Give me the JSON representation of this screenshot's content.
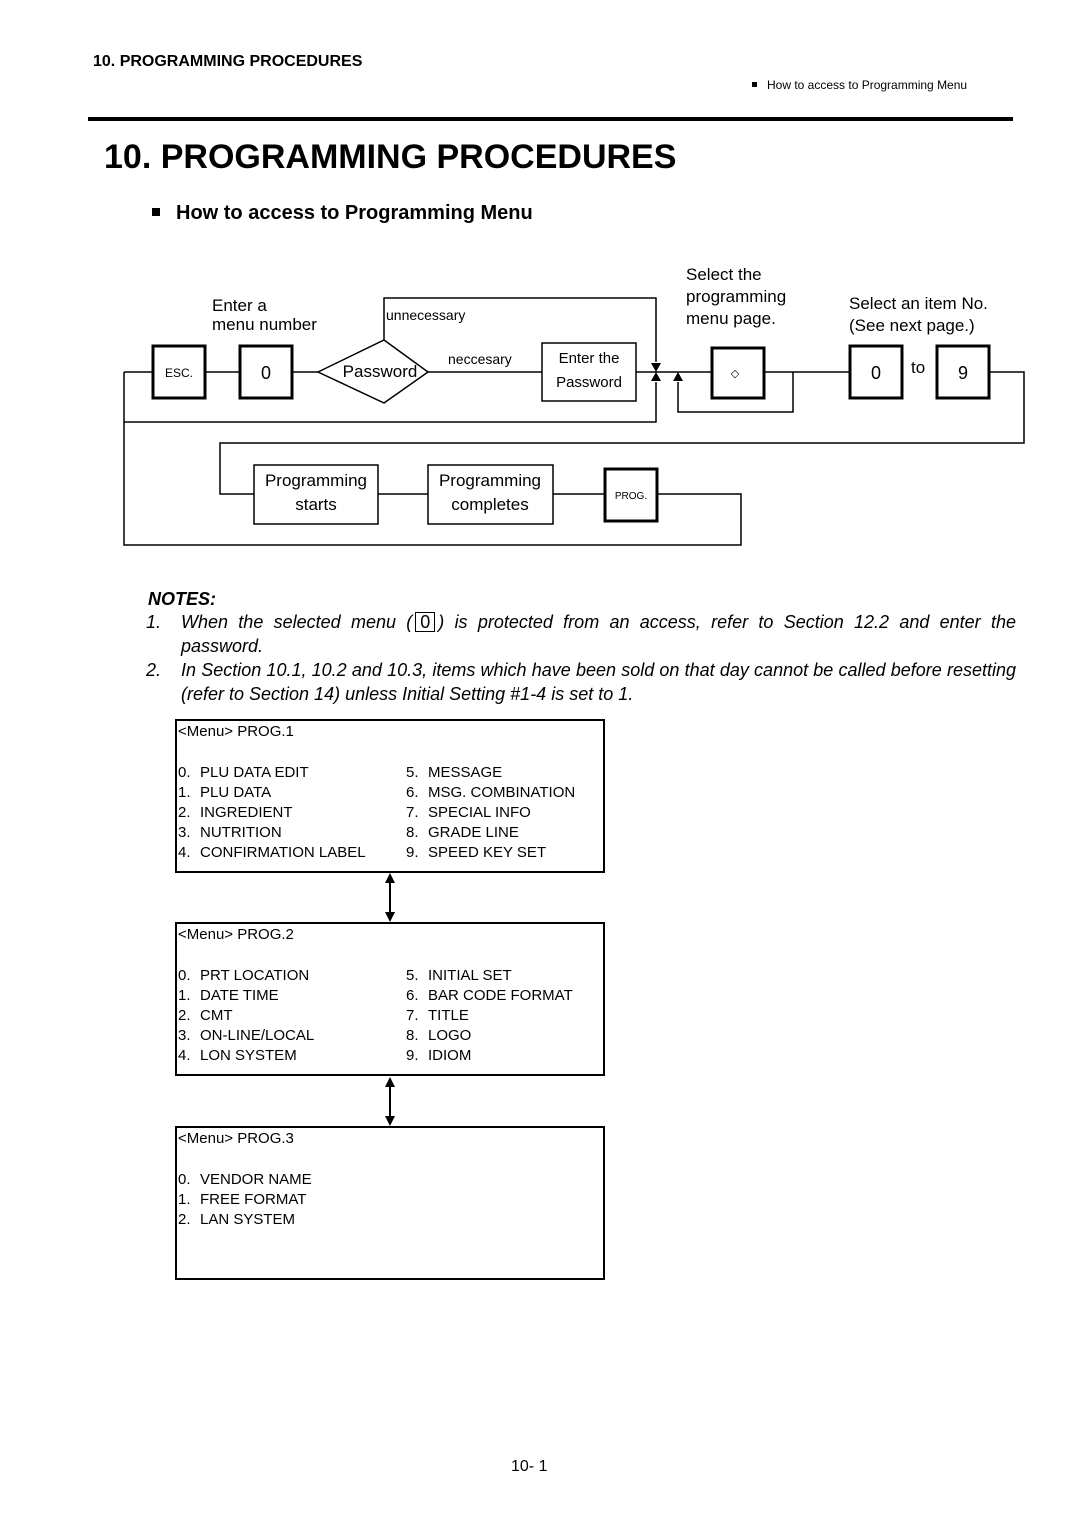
{
  "header": {
    "running_title": "10. PROGRAMMING PROCEDURES",
    "running_section": "How to access to Programming Menu"
  },
  "chapter_title": "10.  PROGRAMMING PROCEDURES",
  "section_heading": "How to access to Programming Menu",
  "flow": {
    "enter_menu_line1": "Enter a",
    "enter_menu_line2": "menu number",
    "unnecessary": "unnecessary",
    "neccesary": "neccesary",
    "select_page_line1": "Select the",
    "select_page_line2": "programming",
    "select_page_line3": "menu page.",
    "select_item_line1": "Select an item No.",
    "select_item_line2": "(See next page.)",
    "esc_key": "ESC.",
    "zero_key": "0",
    "password_decision": "Password",
    "enter_password_line1": "Enter the",
    "enter_password_line2": "Password",
    "page_key_glyph": "◇",
    "item_key_from": "0",
    "to_label": "to",
    "item_key_to": "9",
    "prog_starts_line1": "Programming",
    "prog_starts_line2": "starts",
    "prog_completes_line1": "Programming",
    "prog_completes_line2": "completes",
    "prog_key": "PROG."
  },
  "notes": {
    "title": "NOTES:",
    "items": [
      {
        "num": "1.",
        "before": "When the selected menu (",
        "key": "0",
        "after": ") is protected from  an access, refer to Section 12.2 and enter the password."
      },
      {
        "num": "2.",
        "text": "In Section 10.1, 10.2 and 10.3, items which have been sold on that day cannot be called before resetting (refer to Section 14) unless Initial Setting #1-4 is set to 1."
      }
    ]
  },
  "menus": [
    {
      "title": "<Menu> PROG.1",
      "left": [
        {
          "idx": "0.",
          "label": "PLU DATA EDIT"
        },
        {
          "idx": "1.",
          "label": "PLU DATA"
        },
        {
          "idx": "2.",
          "label": "INGREDIENT"
        },
        {
          "idx": "3.",
          "label": "NUTRITION"
        },
        {
          "idx": "4.",
          "label": "CONFIRMATION LABEL"
        }
      ],
      "right": [
        {
          "idx": "5.",
          "label": "MESSAGE"
        },
        {
          "idx": "6.",
          "label": "MSG. COMBINATION"
        },
        {
          "idx": "7.",
          "label": "SPECIAL INFO"
        },
        {
          "idx": "8.",
          "label": "GRADE LINE"
        },
        {
          "idx": "9.",
          "label": "SPEED KEY SET"
        }
      ]
    },
    {
      "title": "<Menu> PROG.2",
      "left": [
        {
          "idx": "0.",
          "label": "PRT LOCATION"
        },
        {
          "idx": "1.",
          "label": "DATE TIME"
        },
        {
          "idx": "2.",
          "label": "CMT"
        },
        {
          "idx": "3.",
          "label": "ON-LINE/LOCAL"
        },
        {
          "idx": "4.",
          "label": "LON SYSTEM"
        }
      ],
      "right": [
        {
          "idx": "5.",
          "label": "INITIAL SET"
        },
        {
          "idx": "6.",
          "label": "BAR CODE FORMAT"
        },
        {
          "idx": "7.",
          "label": "TITLE"
        },
        {
          "idx": "8.",
          "label": "LOGO"
        },
        {
          "idx": "9.",
          "label": "IDIOM"
        }
      ]
    },
    {
      "title": "<Menu> PROG.3",
      "left": [
        {
          "idx": "0.",
          "label": "VENDOR NAME"
        },
        {
          "idx": "1.",
          "label": "FREE FORMAT"
        },
        {
          "idx": "2.",
          "label": "LAN SYSTEM"
        }
      ],
      "right": []
    }
  ],
  "page_number": "10- 1"
}
